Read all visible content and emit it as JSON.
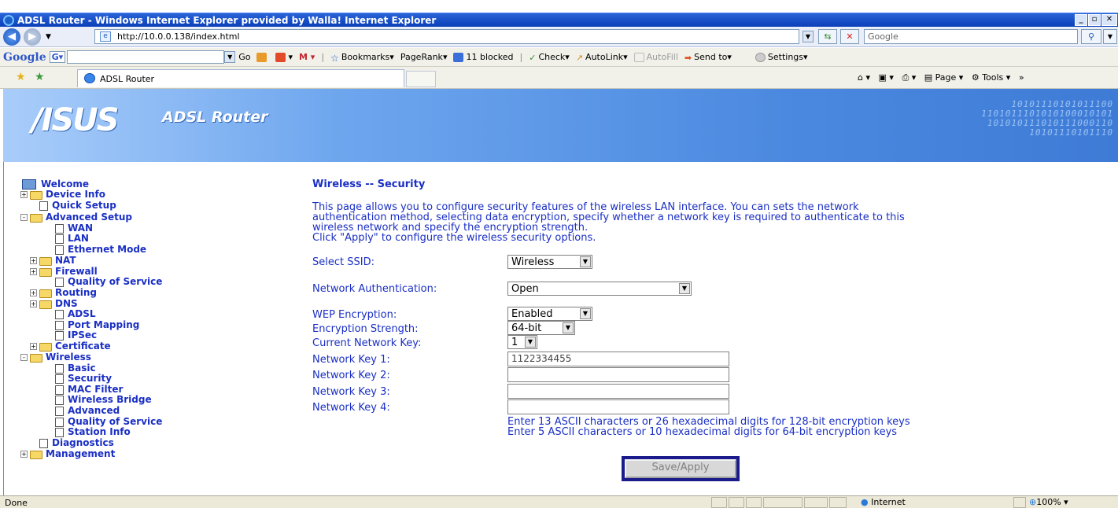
{
  "window": {
    "title": "ADSL Router - Windows Internet Explorer provided by Walla! Internet Explorer"
  },
  "address_bar": {
    "url": "http://10.0.0.138/index.html",
    "search_placeholder": "Google"
  },
  "google_toolbar": {
    "logo": "Google",
    "go_label": "Go",
    "items": [
      "Bookmarks",
      "PageRank",
      "11 blocked",
      "Check",
      "AutoLink",
      "AutoFill",
      "Send to",
      "Settings"
    ]
  },
  "tab": {
    "title": "ADSL Router"
  },
  "ie_tools": {
    "page_label": "Page",
    "tools_label": "Tools"
  },
  "banner": {
    "logo": "/ISUS",
    "product": "ADSL Router",
    "binary_lines": [
      "10101110101011100",
      "1101011101010100010101",
      "101010111010111000110",
      "10101110101110"
    ]
  },
  "tree": [
    {
      "label": "Welcome",
      "level": 0,
      "kind": "pc"
    },
    {
      "label": "Device Info",
      "level": 0,
      "kind": "folder",
      "toggle": "+"
    },
    {
      "label": "Quick Setup",
      "level": 1,
      "kind": "doc"
    },
    {
      "label": "Advanced Setup",
      "level": 0,
      "kind": "folder",
      "toggle": "-"
    },
    {
      "label": "WAN",
      "level": 2,
      "kind": "doc"
    },
    {
      "label": "LAN",
      "level": 2,
      "kind": "doc"
    },
    {
      "label": "Ethernet Mode",
      "level": 2,
      "kind": "doc"
    },
    {
      "label": "NAT",
      "level": 1,
      "kind": "folder",
      "toggle": "+"
    },
    {
      "label": "Firewall",
      "level": 1,
      "kind": "folder",
      "toggle": "+"
    },
    {
      "label": "Quality of Service",
      "level": 2,
      "kind": "doc"
    },
    {
      "label": "Routing",
      "level": 1,
      "kind": "folder",
      "toggle": "+"
    },
    {
      "label": "DNS",
      "level": 1,
      "kind": "folder",
      "toggle": "+"
    },
    {
      "label": "ADSL",
      "level": 2,
      "kind": "doc"
    },
    {
      "label": "Port Mapping",
      "level": 2,
      "kind": "doc"
    },
    {
      "label": "IPSec",
      "level": 2,
      "kind": "doc"
    },
    {
      "label": "Certificate",
      "level": 1,
      "kind": "folder",
      "toggle": "+"
    },
    {
      "label": "Wireless",
      "level": 0,
      "kind": "folder",
      "toggle": "-"
    },
    {
      "label": "Basic",
      "level": 2,
      "kind": "doc"
    },
    {
      "label": "Security",
      "level": 2,
      "kind": "doc"
    },
    {
      "label": "MAC Filter",
      "level": 2,
      "kind": "doc"
    },
    {
      "label": "Wireless Bridge",
      "level": 2,
      "kind": "doc"
    },
    {
      "label": "Advanced",
      "level": 2,
      "kind": "doc"
    },
    {
      "label": "Quality of Service",
      "level": 2,
      "kind": "doc"
    },
    {
      "label": "Station Info",
      "level": 2,
      "kind": "doc"
    },
    {
      "label": "Diagnostics",
      "level": 1,
      "kind": "doc"
    },
    {
      "label": "Management",
      "level": 0,
      "kind": "folder",
      "toggle": "+"
    }
  ],
  "page": {
    "title": "Wireless -- Security",
    "description": [
      "This page allows you to configure security features of the wireless LAN interface. You can sets the network",
      "authentication method, selecting data encryption, specify whether a network key is required to authenticate to this",
      "wireless network and specify the encryption strength.",
      "Click \"Apply\" to configure the wireless security options."
    ],
    "select_ssid": {
      "label": "Select SSID:",
      "value": "Wireless"
    },
    "network_auth": {
      "label": "Network Authentication:",
      "value": "Open"
    },
    "wep": {
      "label": "WEP Encryption:",
      "value": "Enabled"
    },
    "strength": {
      "label": "Encryption Strength:",
      "value": "64-bit"
    },
    "current_key": {
      "label": "Current Network Key:",
      "value": "1"
    },
    "keys": [
      {
        "label": "Network Key 1:",
        "value": "1122334455"
      },
      {
        "label": "Network Key 2:",
        "value": ""
      },
      {
        "label": "Network Key 3:",
        "value": ""
      },
      {
        "label": "Network Key 4:",
        "value": ""
      }
    ],
    "hints": [
      "Enter 13 ASCII characters or 26 hexadecimal digits for 128-bit encryption keys",
      "Enter 5 ASCII characters or 10 hexadecimal digits for 64-bit encryption keys"
    ],
    "save_label": "Save/Apply"
  },
  "status_bar": {
    "text": "Done",
    "zone": "Internet",
    "zoom": "100%"
  }
}
